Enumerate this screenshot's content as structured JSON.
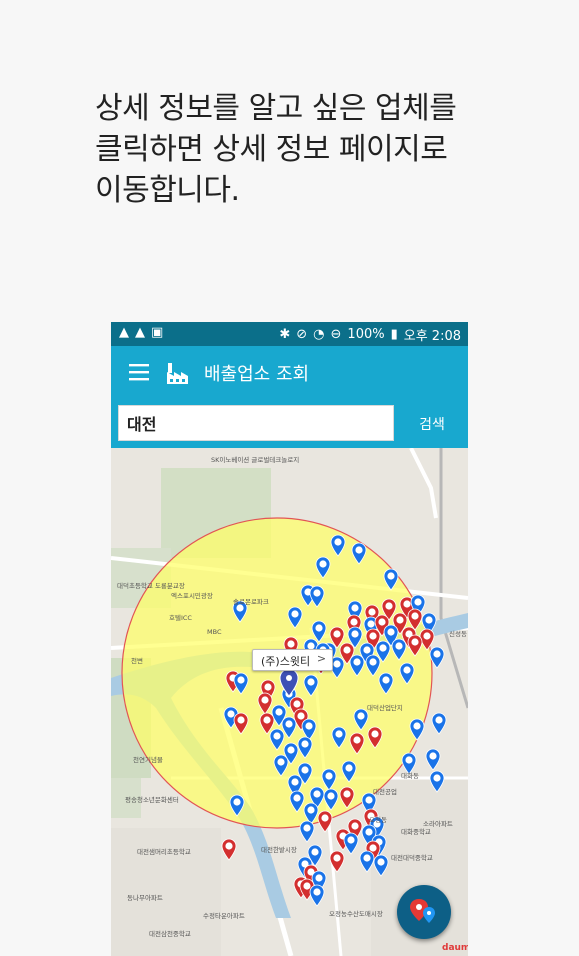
{
  "instruction": "상세 정보를 알고 싶은 업체를\n클릭하면 상세 정보 페이지로\n이동합니다.",
  "status_bar": {
    "battery": "100%",
    "time": "오후 2:08"
  },
  "app_bar": {
    "title": "배출업소 조회"
  },
  "search": {
    "value": "대전",
    "button_label": "검색"
  },
  "map": {
    "callout_label": "(주)스윗티",
    "place_labels": [
      "SK이노베이션 글로벌테크놀로지",
      "대덕초등학교 도룡분교장",
      "엑스포시민광장",
      "솔로몬로파크",
      "MBC",
      "호텔ICC",
      "신성동",
      "천변",
      "천연기념물",
      "평송청소년문화센터",
      "대전샘머리초등학교",
      "대전대덕중학교",
      "동나무아파트",
      "대전삼천중학교",
      "수정타운아파트",
      "대전한밭시장",
      "오정농수산도매시장",
      "대화동",
      "대화중학교",
      "대전공업",
      "소라아파트",
      "대덕산업단지",
      "오정동"
    ],
    "marker_colors": {
      "blue": "#1a73e8",
      "red": "#d32f2f"
    },
    "radius_fill": "#ffff66"
  },
  "colors": {
    "status_bar": "#0b6f8a",
    "app_bar": "#18a8cf",
    "fab": "#0d5f86"
  },
  "icons": [
    "warning-icon",
    "image-icon",
    "bluetooth-icon",
    "mute-icon",
    "wifi-icon",
    "dnd-icon",
    "battery-icon",
    "menu-icon",
    "factory-icon",
    "location-fab-icon"
  ]
}
